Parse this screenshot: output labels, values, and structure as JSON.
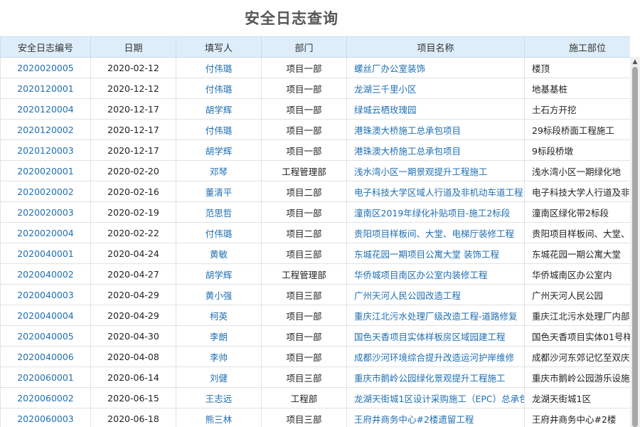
{
  "title": "安全日志查询",
  "columns": [
    "安全日志编号",
    "日期",
    "填写人",
    "部门",
    "项目名称",
    "施工部位"
  ],
  "rows": [
    {
      "id": "2020020005",
      "date": "2020-02-12",
      "author": "付伟璐",
      "dept": "项目一部",
      "project": "螺丝厂办公室装饰",
      "part": "楼顶"
    },
    {
      "id": "2020120001",
      "date": "2020-12-12",
      "author": "付伟璐",
      "dept": "项目一部",
      "project": "龙湖三千里小区",
      "part": "地基基桩"
    },
    {
      "id": "2020120004",
      "date": "2020-12-17",
      "author": "胡学辉",
      "dept": "项目一部",
      "project": "绿城云栖玫瑰园",
      "part": "土石方开挖"
    },
    {
      "id": "2020120002",
      "date": "2020-12-17",
      "author": "付伟璐",
      "dept": "项目一部",
      "project": "港珠澳大桥施工总承包项目",
      "part": "29标段桥面工程施工"
    },
    {
      "id": "2020120003",
      "date": "2020-12-17",
      "author": "胡学辉",
      "dept": "项目一部",
      "project": "港珠澳大桥施工总承包项目",
      "part": "9标段桥墩"
    },
    {
      "id": "2020020001",
      "date": "2020-02-20",
      "author": "邓琴",
      "dept": "工程管理部",
      "project": "浅水湾小区一期景观提升工程施工",
      "part": "浅水湾小区一期绿化地"
    },
    {
      "id": "2020020002",
      "date": "2020-02-16",
      "author": "董清平",
      "dept": "项目二部",
      "project": "电子科技大学区域人行道及非机动车道工程",
      "part": "电子科技大学人行道及非"
    },
    {
      "id": "2020020003",
      "date": "2020-02-19",
      "author": "范思哲",
      "dept": "项目一部",
      "project": "潼南区2019年绿化补贴项目-施工2标段",
      "part": "潼南区绿化带2标段"
    },
    {
      "id": "2020020004",
      "date": "2020-02-22",
      "author": "付伟璐",
      "dept": "项目二部",
      "project": "贵阳项目样板间、大堂、电梯厅装修工程",
      "part": "贵阳项目样板间、大堂、"
    },
    {
      "id": "2020040001",
      "date": "2020-04-24",
      "author": "黄敏",
      "dept": "项目三部",
      "project": "东城花园一期项目公寓大堂 装饰工程",
      "part": "东城花园一期公寓大堂"
    },
    {
      "id": "2020040002",
      "date": "2020-04-27",
      "author": "胡学辉",
      "dept": "工程管理部",
      "project": "华侨城项目南区办公室内装修工程",
      "part": "华侨城南区办公室内"
    },
    {
      "id": "2020040003",
      "date": "2020-04-29",
      "author": "黄小强",
      "dept": "项目三部",
      "project": "广州天河人民公园改造工程",
      "part": "广州天河人民公园"
    },
    {
      "id": "2020040004",
      "date": "2020-04-29",
      "author": "柯英",
      "dept": "项目一部",
      "project": "重庆江北污水处理厂级改造工程-道路修复",
      "part": "重庆江北污水处理厂内部"
    },
    {
      "id": "2020040005",
      "date": "2020-04-30",
      "author": "李朗",
      "dept": "项目一部",
      "project": "国色天香项目实体样板房区域园建工程",
      "part": "国色天香项目实体01号样"
    },
    {
      "id": "2020040006",
      "date": "2020-04-08",
      "author": "李帅",
      "dept": "项目一部",
      "project": "成都沙河环境综合提升改造运河护岸维修",
      "part": "成都沙河东郊记忆至双庆"
    },
    {
      "id": "2020060001",
      "date": "2020-06-14",
      "author": "刘健",
      "dept": "项目三部",
      "project": "重庆市鹅岭公园绿化景观提升工程施工",
      "part": "重庆市鹅岭公园游乐设施"
    },
    {
      "id": "2020060002",
      "date": "2020-06-15",
      "author": "王志远",
      "dept": "工程部",
      "project": "龙湖天街城1区设计采购施工（EPC）总承包",
      "part": "龙湖天街城1区"
    },
    {
      "id": "2020060003",
      "date": "2020-06-18",
      "author": "熊三林",
      "dept": "项目三部",
      "project": "王府井商务中心#2楼遗留工程",
      "part": "王府井商务中心#2楼"
    }
  ]
}
